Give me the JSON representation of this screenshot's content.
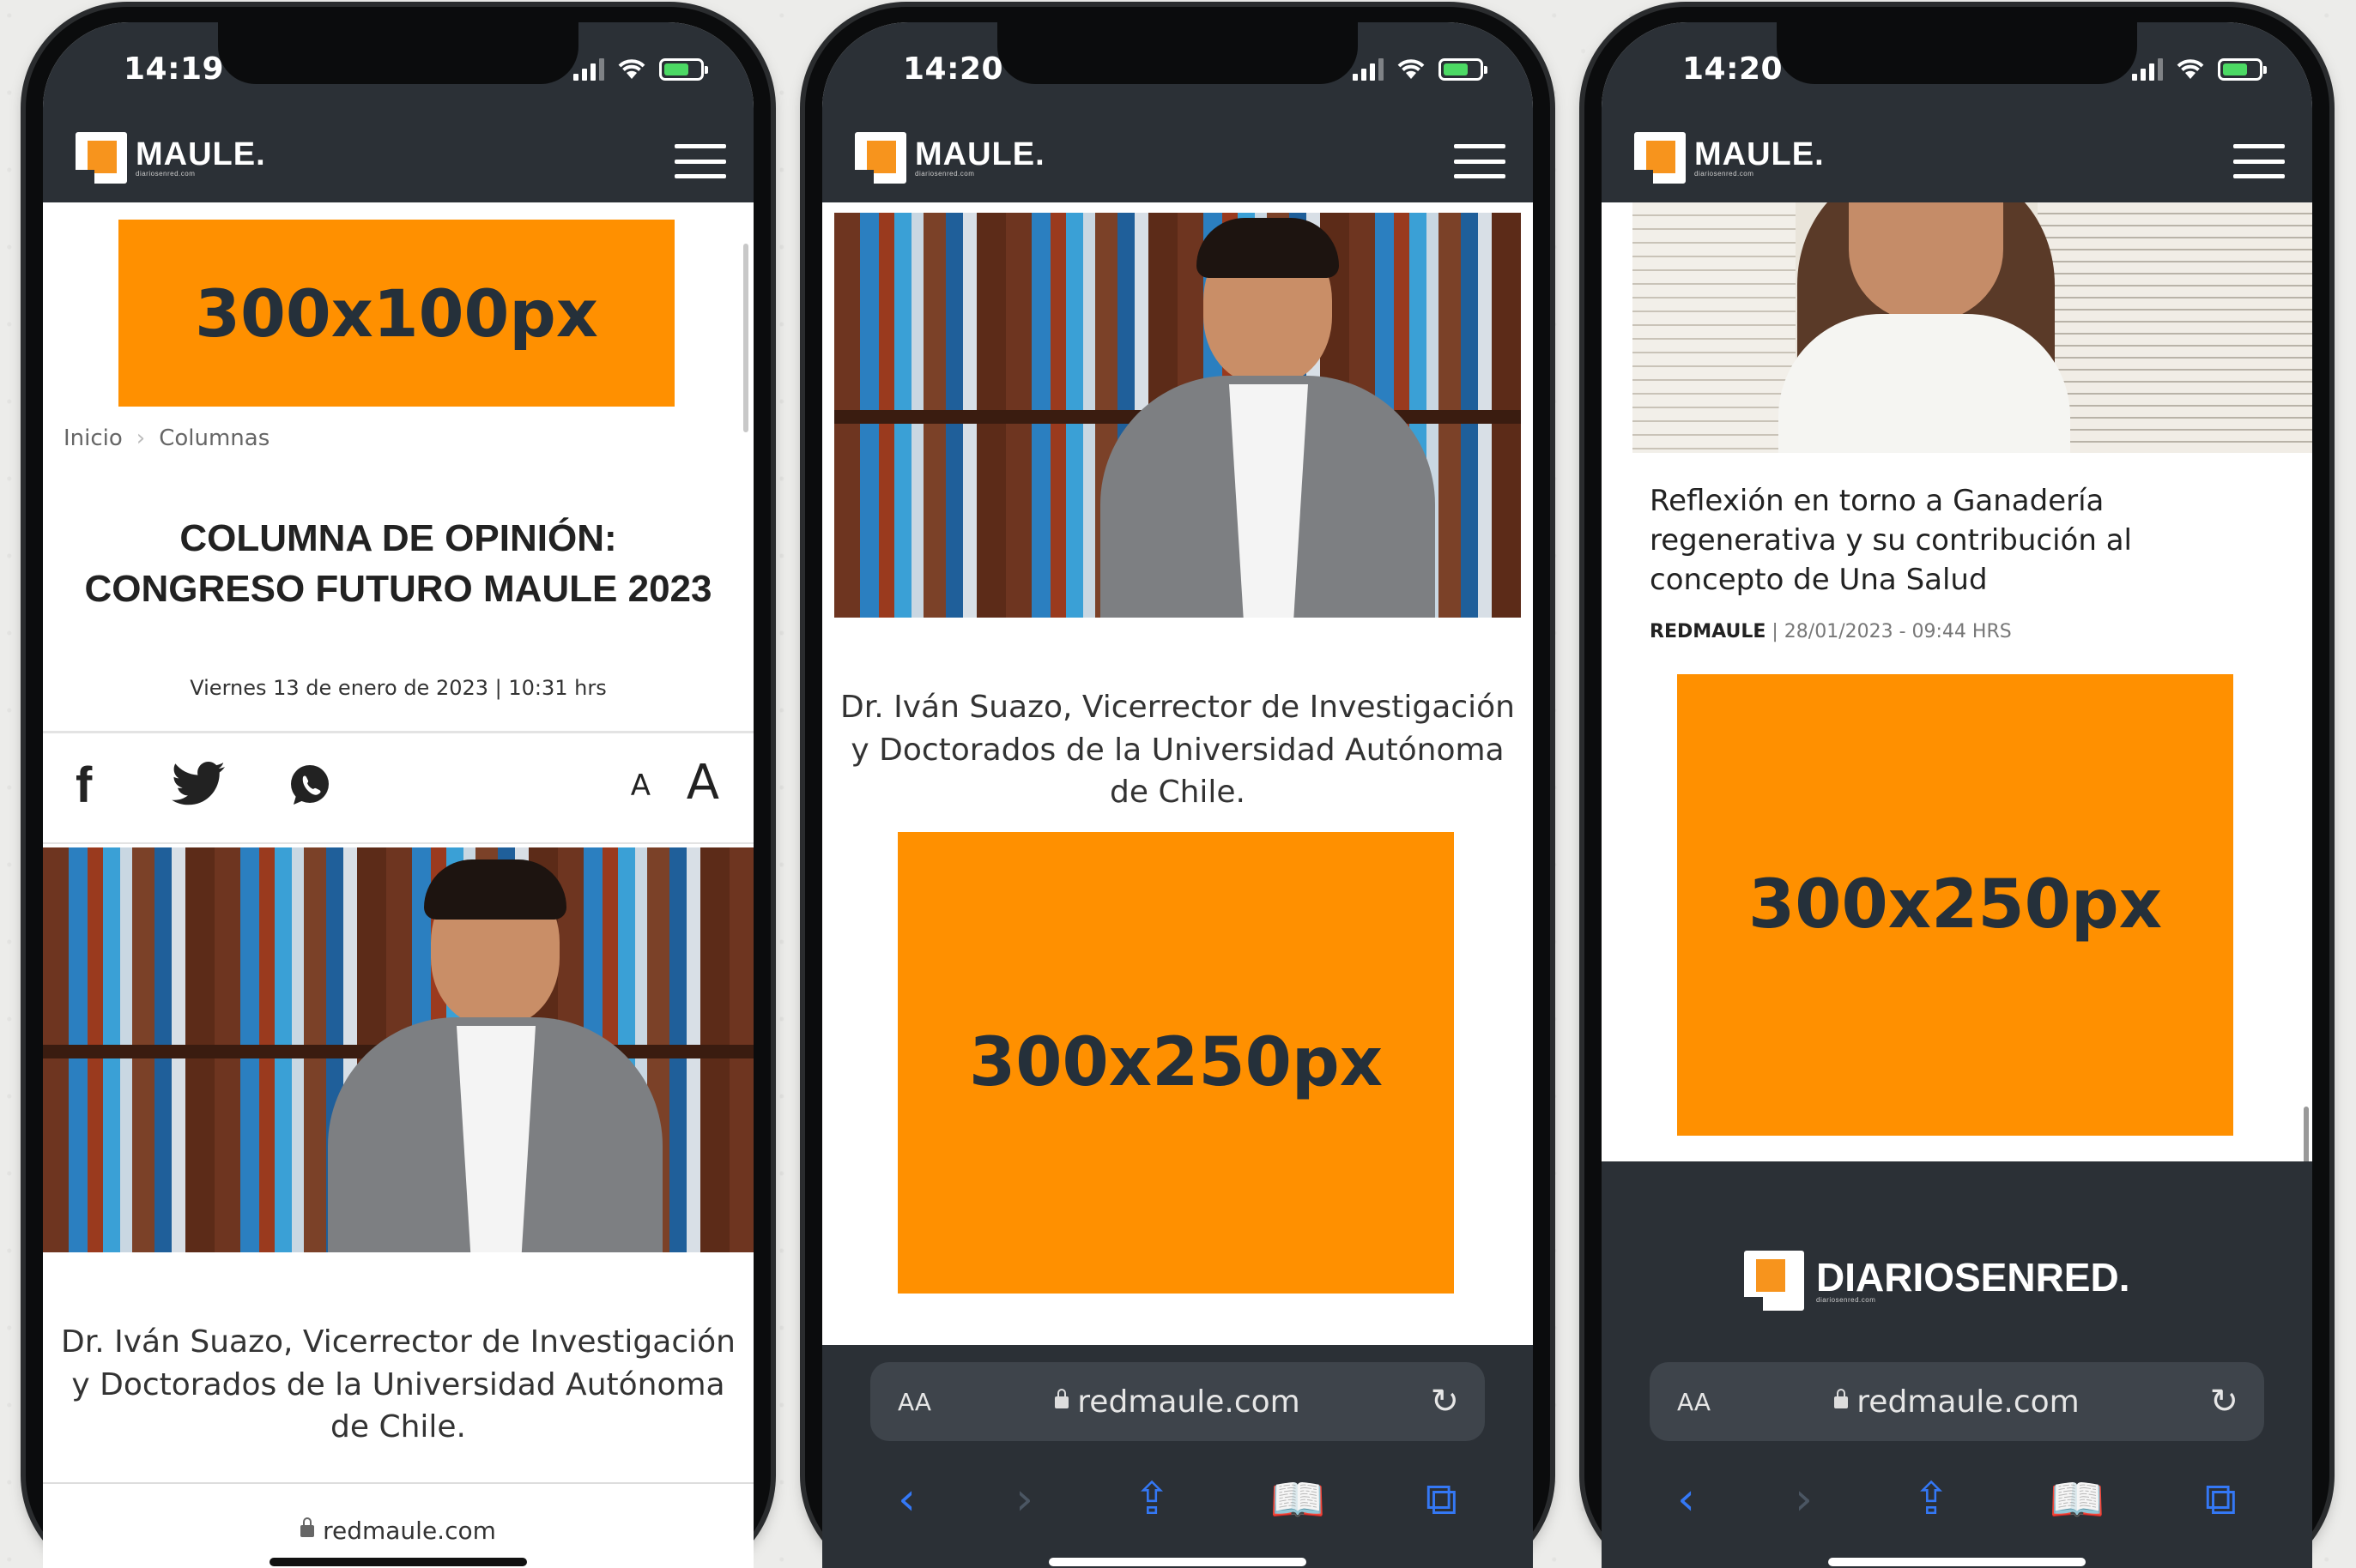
{
  "brand": {
    "name": "MAULE.",
    "subline": "diariosenred.com",
    "footer_name": "DIARIOSENRED.",
    "footer_sub": "diariosenred.com"
  },
  "colors": {
    "ad": "#ff9000",
    "header": "#2b3036",
    "ad_text": "#25303a"
  },
  "phone1": {
    "time": "14:19",
    "ad_label": "300x100px",
    "breadcrumb": {
      "home": "Inicio",
      "separator": "›",
      "section": "Columnas"
    },
    "title_line1": "COLUMNA DE OPINIÓN:",
    "title_line2": "CONGRESO FUTURO MAULE 2023",
    "date": "Viernes 13 de enero de 2023 | 10:31 hrs",
    "share": {
      "facebook": "f",
      "font_small": "A",
      "font_large": "A"
    },
    "caption": "Dr. Iván Suazo, Vicerrector de Investigación y Doctorados de la Universidad Autónoma de Chile.",
    "url": "redmaule.com"
  },
  "phone2": {
    "time": "14:20",
    "caption": "Dr. Iván Suazo, Vicerrector de Investigación y Doctorados de la Universidad Autónoma de Chile.",
    "ad_label": "300x250px",
    "url_aa": "AA",
    "url": "redmaule.com"
  },
  "phone3": {
    "time": "14:20",
    "article_title": "Reflexión en torno a Ganadería regenerativa y su contribución al concepto de Una Salud",
    "article_author": "REDMAULE",
    "article_meta": "| 28/01/2023 - 09:44 HRS",
    "ad_label": "300x250px",
    "url_aa": "AA",
    "url": "redmaule.com"
  }
}
